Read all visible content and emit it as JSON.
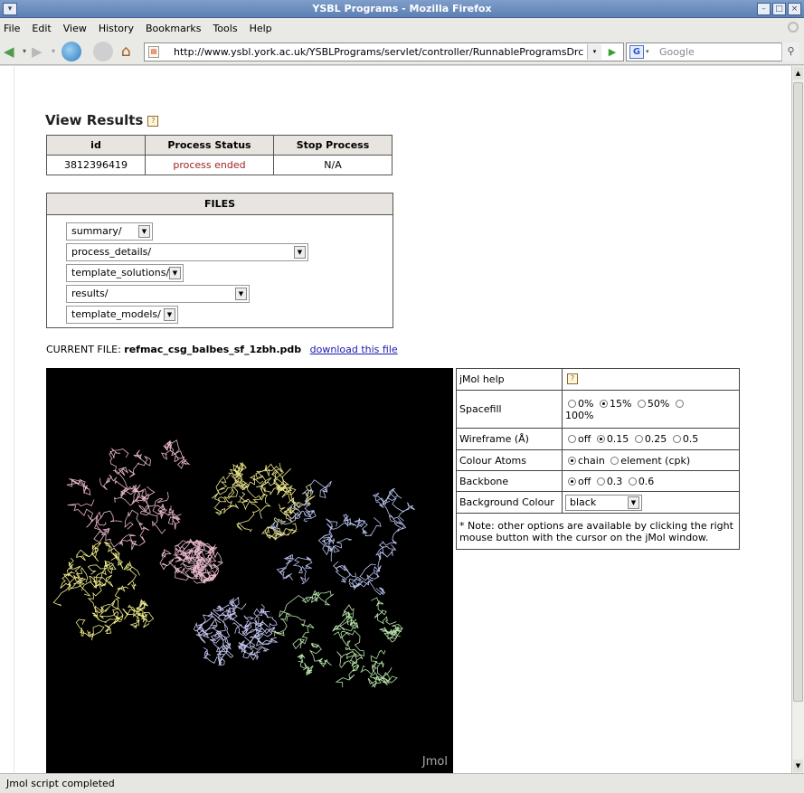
{
  "window": {
    "title": "YSBL Programs - Mozilla Firefox"
  },
  "menu": [
    "File",
    "Edit",
    "View",
    "History",
    "Bookmarks",
    "Tools",
    "Help"
  ],
  "nav": {
    "url": "http://www.ysbl.york.ac.uk/YSBLPrograms/servlet/controller/RunnableProgramsDrc",
    "search_placeholder": "Google",
    "search_engine": "G"
  },
  "page": {
    "title": "View Results",
    "process_table": {
      "headers": [
        "id",
        "Process Status",
        "Stop Process"
      ],
      "row": {
        "id": "3812396419",
        "status": "process ended",
        "stop": "N/A"
      }
    },
    "files": {
      "header": "FILES",
      "selects": [
        "summary/",
        "process_details/",
        "template_solutions/",
        "results/",
        "template_models/"
      ]
    },
    "current_file": {
      "label": "CURRENT FILE:",
      "name": "refmac_csg_balbes_sf_1zbh.pdb",
      "download": "download this file"
    },
    "jmol_label": "Jmol",
    "options": {
      "help": "jMol help",
      "spacefill": {
        "label": "Spacefill",
        "choices": [
          "0%",
          "15%",
          "50%",
          "100%"
        ],
        "selected": "15%"
      },
      "wireframe": {
        "label": "Wireframe (Å)",
        "choices": [
          "off",
          "0.15",
          "0.25",
          "0.5"
        ],
        "selected": "0.15"
      },
      "colour_atoms": {
        "label": "Colour Atoms",
        "choices": [
          "chain",
          "element (cpk)"
        ],
        "selected": "chain"
      },
      "backbone": {
        "label": "Backbone",
        "choices": [
          "off",
          "0.3",
          "0.6"
        ],
        "selected": "off"
      },
      "background": {
        "label": "Background Colour",
        "value": "black"
      },
      "note": "* Note: other options are available by clicking the right mouse button with the cursor on the jMol window."
    }
  },
  "status": "Jmol script completed"
}
